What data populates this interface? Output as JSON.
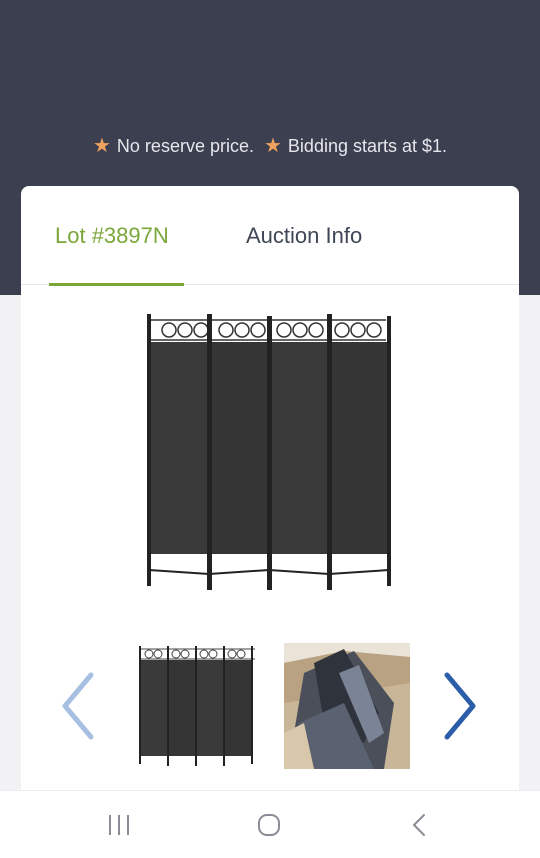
{
  "promo": {
    "text_1": "No reserve price.",
    "text_2": "Bidding starts at $1.",
    "star_icon": "star-icon",
    "star_color": "#f0a35e"
  },
  "tabs": [
    {
      "label": "Lot #3897N",
      "active": true
    },
    {
      "label": "Auction Info",
      "active": false
    }
  ],
  "colors": {
    "header_bg": "#3b3f50",
    "accent": "#7aa63a",
    "arrow_left": "#a7bfe0",
    "arrow_right": "#2c5da8"
  },
  "gallery": {
    "main_image": "room-divider-screen-photo",
    "thumbnails": [
      {
        "image": "room-divider-thumbnail"
      },
      {
        "image": "boxed-item-thumbnail"
      }
    ],
    "prev_icon": "chevron-left-icon",
    "next_icon": "chevron-right-icon"
  },
  "system_nav": {
    "recent_icon": "recent-apps-icon",
    "home_icon": "home-icon",
    "back_icon": "back-icon"
  }
}
